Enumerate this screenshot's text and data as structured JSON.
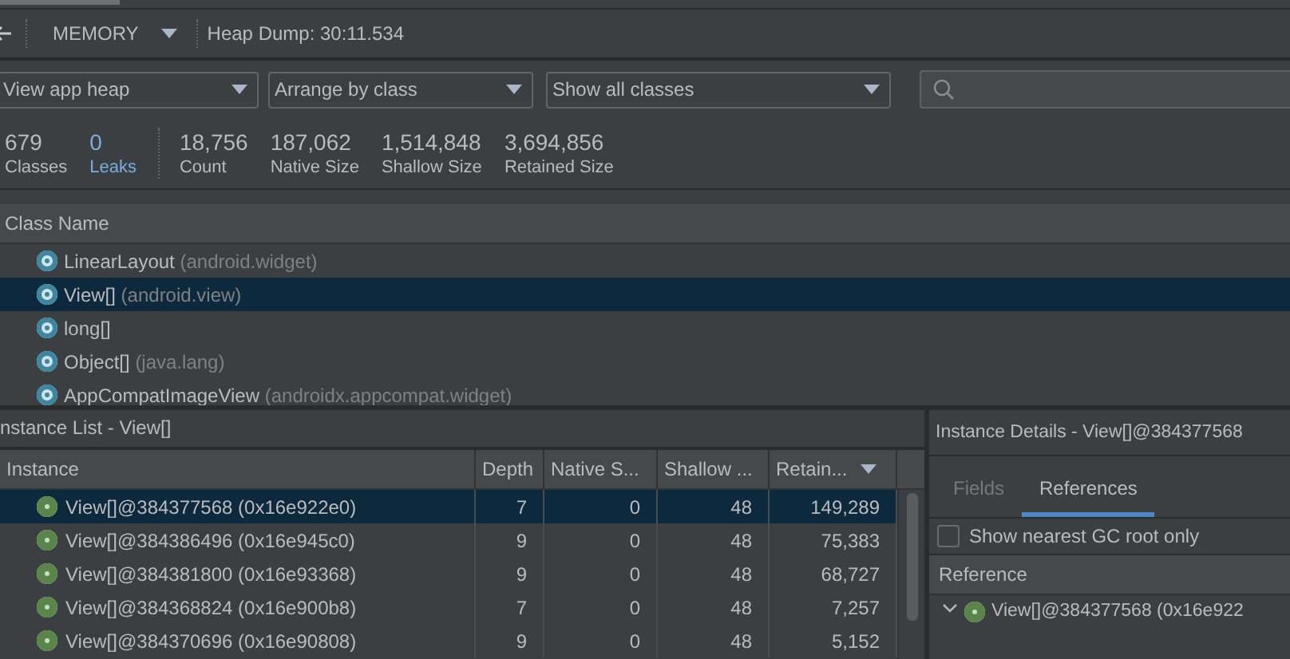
{
  "toolbar": {
    "profiler": "MEMORY",
    "session": "Heap Dump: 30:11.534"
  },
  "filters": [
    {
      "value": "View app heap"
    },
    {
      "value": "Arrange by class"
    },
    {
      "value": "Show all classes"
    }
  ],
  "stats": [
    {
      "value": "679",
      "label": "Classes",
      "kind": "plain"
    },
    {
      "value": "0",
      "label": "Leaks",
      "kind": "link"
    },
    {
      "value": "18,756",
      "label": "Count",
      "kind": "plain"
    },
    {
      "value": "187,062",
      "label": "Native Size",
      "kind": "plain"
    },
    {
      "value": "1,514,848",
      "label": "Shallow Size",
      "kind": "plain"
    },
    {
      "value": "3,694,856",
      "label": "Retained Size",
      "kind": "plain"
    }
  ],
  "class_table": {
    "column": "Class Name",
    "rows": [
      {
        "name": "LinearLayout",
        "package": "(android.widget)",
        "selected": false
      },
      {
        "name": "View[]",
        "package": "(android.view)",
        "selected": true
      },
      {
        "name": "long[]",
        "selected": false
      },
      {
        "name": "Object[]",
        "package": "(java.lang)",
        "selected": false
      },
      {
        "name": "AppCompatImageView",
        "package": "(androidx.appcompat.widget)",
        "selected": false
      }
    ]
  },
  "instance_list": {
    "title": "nstance List - View[]",
    "columns": [
      "Instance",
      "Depth",
      "Native S...",
      "Shallow ...",
      "Retain..."
    ],
    "rows": [
      {
        "instance": "View[]@384377568 (0x16e922e0)",
        "depth": "7",
        "native": "0",
        "shallow": "48",
        "retained": "149,289",
        "selected": true
      },
      {
        "instance": "View[]@384386496 (0x16e945c0)",
        "depth": "9",
        "native": "0",
        "shallow": "48",
        "retained": "75,383",
        "selected": false
      },
      {
        "instance": "View[]@384381800 (0x16e93368)",
        "depth": "9",
        "native": "0",
        "shallow": "48",
        "retained": "68,727",
        "selected": false
      },
      {
        "instance": "View[]@384368824 (0x16e900b8)",
        "depth": "7",
        "native": "0",
        "shallow": "48",
        "retained": "7,257",
        "selected": false
      },
      {
        "instance": "View[]@384370696 (0x16e90808)",
        "depth": "9",
        "native": "0",
        "shallow": "48",
        "retained": "5,152",
        "selected": false
      }
    ]
  },
  "instance_details": {
    "title": "Instance Details - View[]@384377568",
    "tabs": [
      {
        "label": "Fields",
        "selected": false
      },
      {
        "label": "References",
        "selected": true
      }
    ],
    "nearest_gc_root": {
      "label": "Show nearest GC root only",
      "checked": false
    },
    "column": "Reference",
    "rows": [
      {
        "label": "View[]@384377568 (0x16e922",
        "expanded": true
      }
    ]
  }
}
